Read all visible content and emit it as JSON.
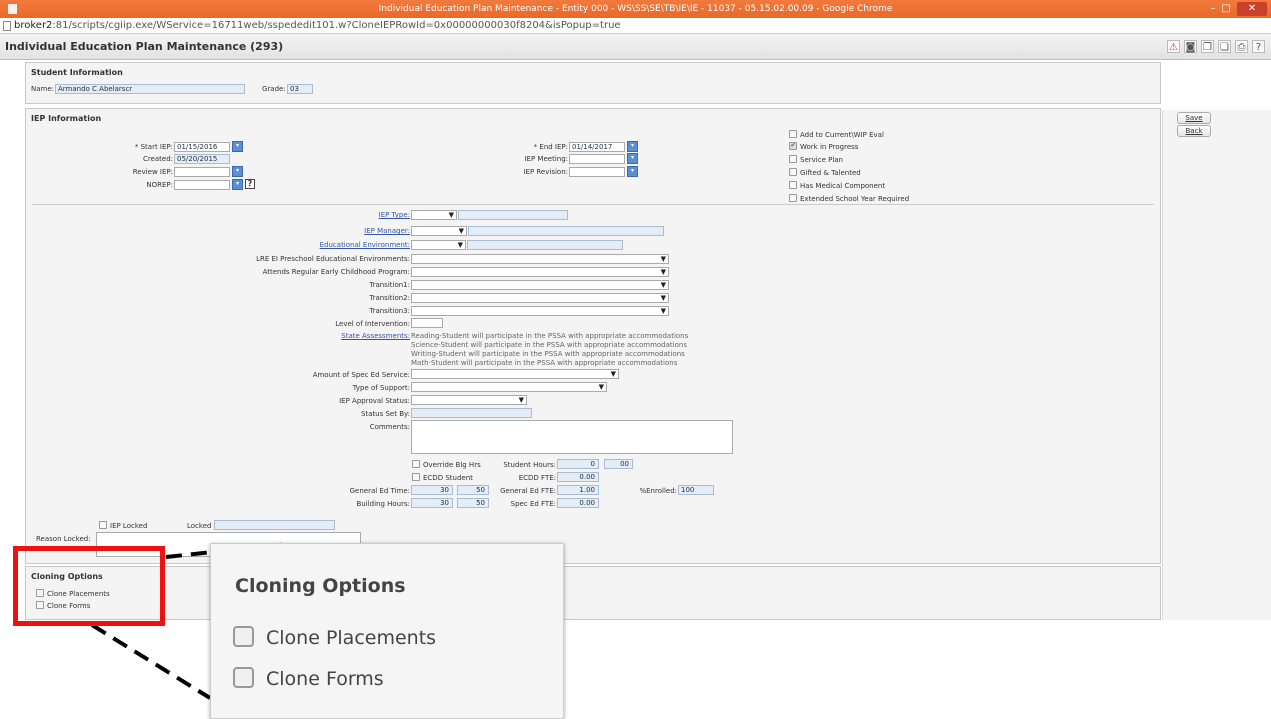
{
  "window": {
    "title": "Individual Education Plan Maintenance - Entity 000 - WS\\SS\\SE\\TB\\IE\\IE - 11037 - 05.15.02.00.09 - Google Chrome",
    "minimize": "–",
    "maximize": "□",
    "close": "✕"
  },
  "address": {
    "host": "broker2",
    "rest": ":81/scripts/cgiip.exe/WService=16711web/sspededit101.w?CloneIEPRowId=0x00000000030f8204&isPopup=true"
  },
  "app": {
    "title": "Individual Education Plan Maintenance (293)",
    "toolbar_icons": [
      "alert-icon",
      "binoculars-icon",
      "copy-icon",
      "paste-icon",
      "print-icon",
      "help-icon"
    ],
    "toolbar_glyphs": [
      "⚠",
      "◙",
      "❐",
      "❏",
      "⎙",
      "?"
    ]
  },
  "student": {
    "section_title": "Student Information",
    "name_label": "Name:",
    "name_value": "Armando C Abelarscr",
    "grade_label": "Grade:",
    "grade_value": "03"
  },
  "iep": {
    "section_title": "IEP Information",
    "start_label": "* Start IEP:",
    "start_value": "01/15/2016",
    "created_label": "Created:",
    "created_value": "05/20/2015",
    "review_label": "Review IEP:",
    "norep_label": "NOREP:",
    "help_glyph": "?",
    "end_label": "* End IEP:",
    "end_value": "01/14/2017",
    "meeting_label": "IEP Meeting:",
    "revision_label": "IEP Revision:",
    "checkboxes": [
      {
        "label": "Add to Current\\WIP Eval",
        "checked": false
      },
      {
        "label": "Work in Progress",
        "checked": true
      },
      {
        "label": "Service Plan",
        "checked": false
      },
      {
        "label": "Gifted & Talented",
        "checked": false
      },
      {
        "label": "Has Medical Component",
        "checked": false
      },
      {
        "label": "Extended School Year Required",
        "checked": false
      }
    ],
    "check_glyph": "✔",
    "iep_type_label": "IEP Type:",
    "iep_manager_label": "IEP Manager:",
    "edu_env_label": "Educational Environment:",
    "lre_label": "LRE EI Preschool Educational Environments:",
    "attends_label": "Attends Regular Early Childhood Program:",
    "transition1_label": "Transition1:",
    "transition2_label": "Transition2:",
    "transition3_label": "Transition3:",
    "level_label": "Level of Intervention:",
    "state_assess_label": "State Assessments:",
    "state_assess_lines": [
      "Reading-Student will participate in the PSSA with appropriate accommodations",
      "Science-Student will participate in the PSSA with appropriate accommodations",
      "Writing-Student will participate in the PSSA with appropriate accommodations",
      "Math-Student will participate in the PSSA with appropriate accommodations"
    ],
    "amount_label": "Amount of Spec Ed Service:",
    "support_label": "Type of Support:",
    "approval_label": "IEP Approval Status:",
    "status_set_label": "Status Set By:",
    "comments_label": "Comments:",
    "override_label": "Override Blg Hrs",
    "ecdd_student_label": "ECDD Student",
    "student_hours_label": "Student Hours:",
    "student_hours_value": "0",
    "student_minutes_value": "00",
    "ecdd_fte_label": "ECDD FTE:",
    "ecdd_fte_value": "0.00",
    "gen_ed_time_label": "General Ed Time:",
    "gen_ed_time_h": "30",
    "gen_ed_time_m": "50",
    "gen_ed_fte_label": "General Ed FTE:",
    "gen_ed_fte_value": "1.00",
    "enrolled_label": "%Enrolled:",
    "enrolled_value": "100",
    "building_hours_label": "Building Hours:",
    "building_hours_h": "30",
    "building_hours_m": "50",
    "spec_ed_fte_label": "Spec Ed FTE:",
    "spec_ed_fte_value": "0.00",
    "iep_locked_label": "IEP Locked",
    "locked_by_label": "Locked by:",
    "reason_locked_label": "Reason Locked:"
  },
  "actions": {
    "save": "Save",
    "back": "Back"
  },
  "cloning": {
    "section_title": "Cloning Options",
    "clone_placements": "Clone Placements",
    "clone_forms": "Clone Forms"
  },
  "callout": {
    "border_color": "#ee1111"
  }
}
